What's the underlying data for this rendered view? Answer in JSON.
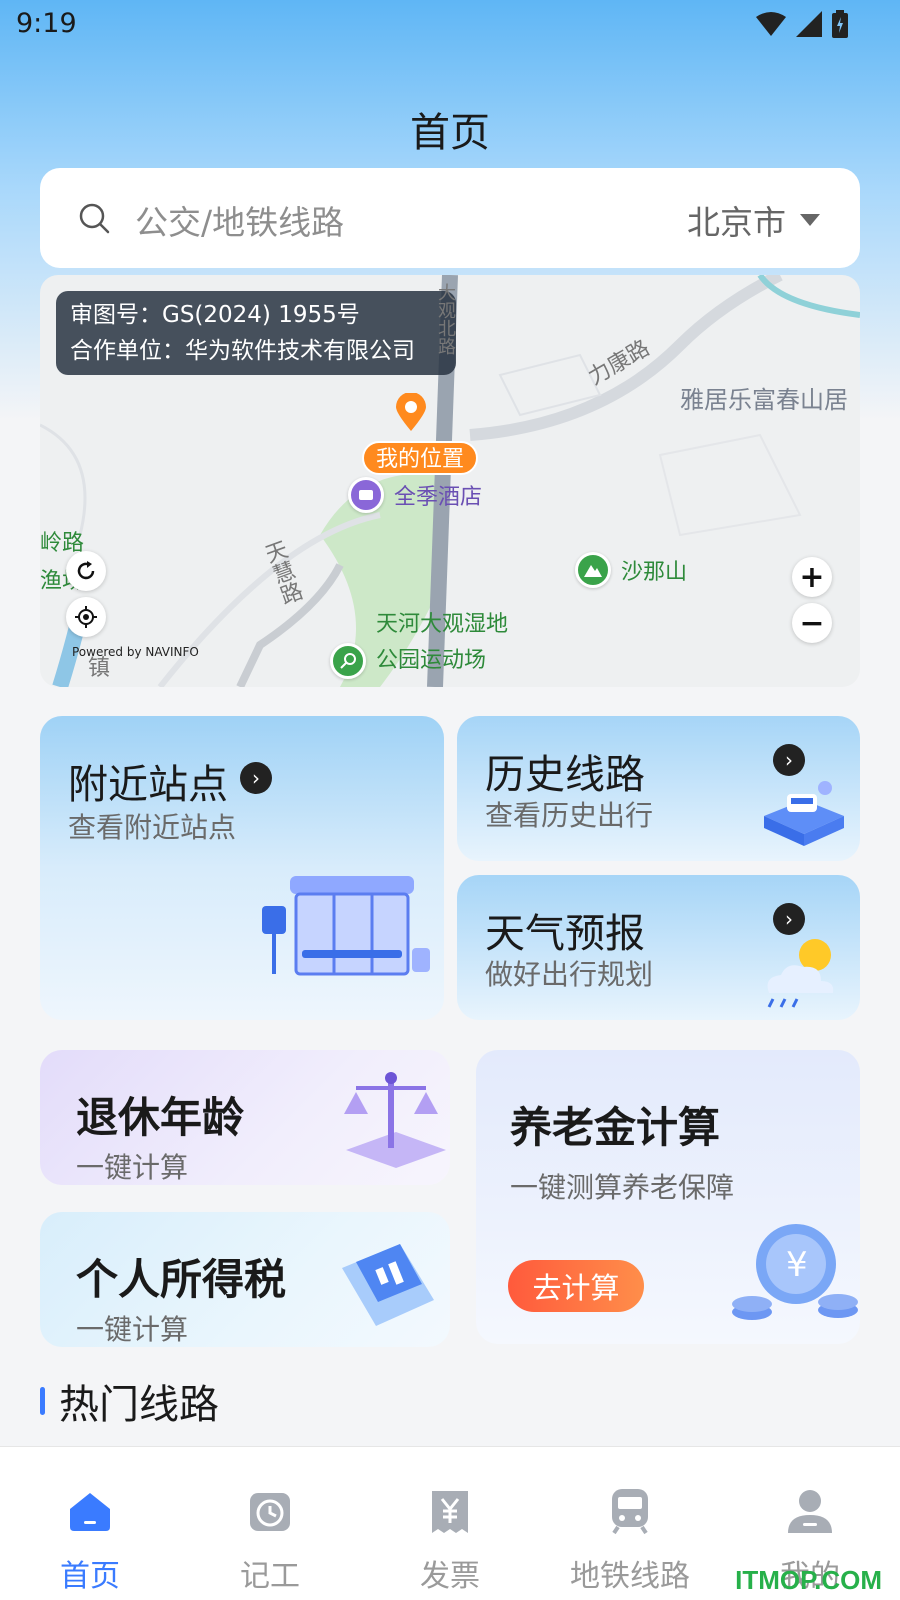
{
  "status_bar": {
    "time": "9:19"
  },
  "header": {
    "title": "首页"
  },
  "search": {
    "placeholder": "公交/地铁线路",
    "city": "北京市"
  },
  "map": {
    "license_line1": "审图号：GS(2024) 1955号",
    "license_line2": "合作单位：华为软件技术有限公司",
    "my_location": "我的位置",
    "labels": {
      "lijiang_road": "力康路",
      "yaju": "雅居乐富春山居",
      "tianhui_road": "天慧路",
      "ling_road": "岭路",
      "yuchang": "渔场",
      "dagui": "大观北路",
      "zhen": "镇"
    },
    "pois": {
      "hotel": "全季酒店",
      "mountain": "沙那山",
      "wetland_line1": "天河大观湿地",
      "wetland_line2": "公园运动场"
    },
    "powered_by": "Powered by NAVINFO",
    "zoom_in": "+",
    "zoom_out": "−"
  },
  "cards": {
    "nearby": {
      "title": "附近站点",
      "subtitle": "查看附近站点"
    },
    "history": {
      "title": "历史线路",
      "subtitle": "查看历史出行"
    },
    "weather": {
      "title": "天气预报",
      "subtitle": "做好出行规划"
    },
    "retire": {
      "title": "退休年龄",
      "subtitle": "一键计算"
    },
    "pension": {
      "title": "养老金计算",
      "subtitle": "一键测算养老保障",
      "button": "去计算"
    },
    "tax": {
      "title": "个人所得税",
      "subtitle": "一键计算"
    }
  },
  "section": {
    "hot_routes": "热门线路"
  },
  "bottom_nav": [
    {
      "label": "首页",
      "icon": "home-icon",
      "active": true
    },
    {
      "label": "记工",
      "icon": "clock-icon",
      "active": false
    },
    {
      "label": "发票",
      "icon": "invoice-icon",
      "active": false
    },
    {
      "label": "地铁线路",
      "icon": "subway-icon",
      "active": false
    },
    {
      "label": "我的",
      "icon": "user-icon",
      "active": false
    }
  ],
  "watermark": "ITMOP.COM",
  "colors": {
    "accent": "#3a7bff",
    "orange": "#ff8a1e",
    "calc_button": "#ff5a3c"
  }
}
